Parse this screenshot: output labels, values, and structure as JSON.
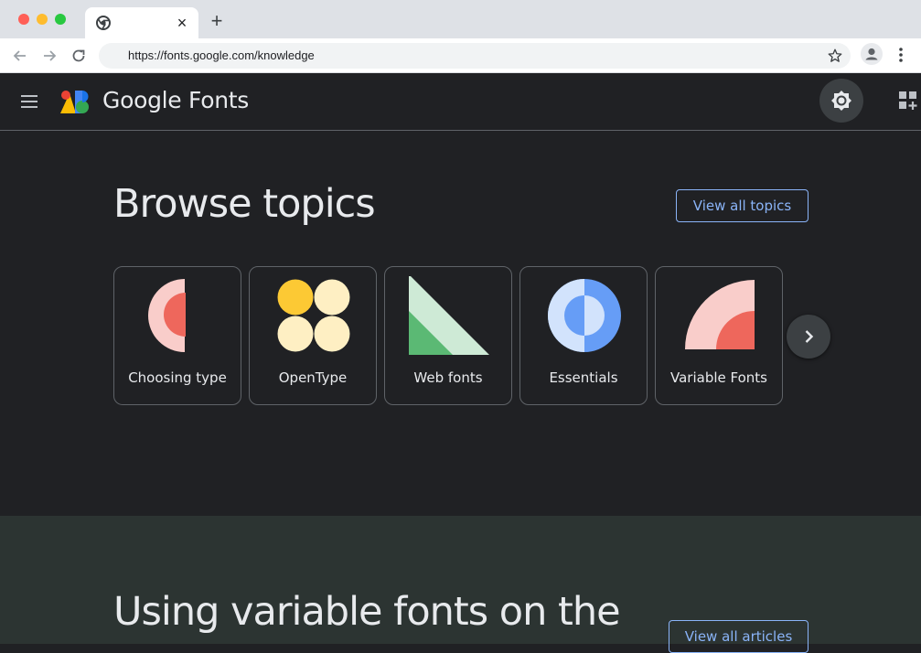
{
  "browser": {
    "url": "https://fonts.google.com/knowledge",
    "tab_close": "×",
    "new_tab": "+"
  },
  "header": {
    "brand": "Google Fonts",
    "icons": [
      "hamburger-icon",
      "google-fonts-logo-icon",
      "brightness-icon",
      "apps-add-icon"
    ]
  },
  "browse": {
    "title": "Browse topics",
    "view_all": "View all topics",
    "topics": [
      {
        "label": "Choosing type",
        "icon": "choosing-type-icon"
      },
      {
        "label": "OpenType",
        "icon": "opentype-icon"
      },
      {
        "label": "Web fonts",
        "icon": "web-fonts-icon"
      },
      {
        "label": "Essentials",
        "icon": "essentials-icon"
      },
      {
        "label": "Variable Fonts",
        "icon": "variable-fonts-icon"
      }
    ]
  },
  "articles": {
    "title": "Using variable fonts on the",
    "view_all": "View all articles"
  },
  "colors": {
    "background": "#202124",
    "accent": "#8ab4f8",
    "articles_bg": "#2c3432"
  }
}
